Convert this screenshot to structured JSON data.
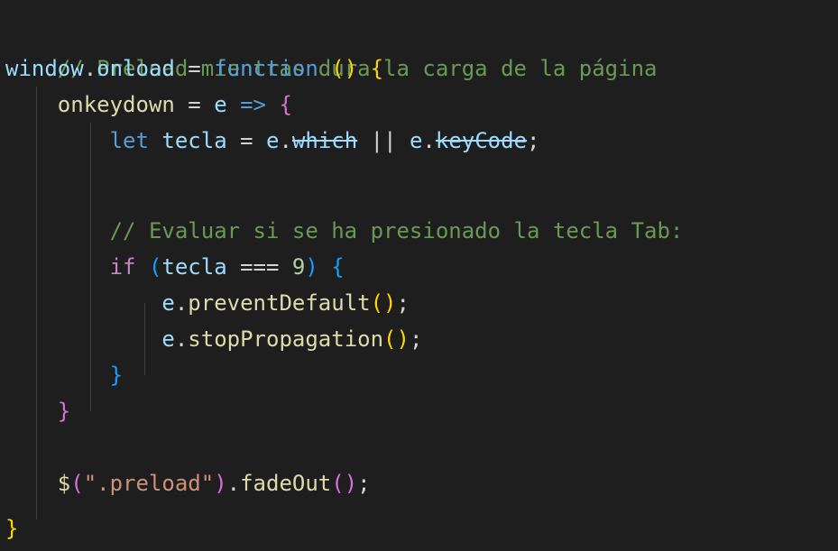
{
  "code": {
    "l1": {
      "comment": "// Preload mientras dura la carga de la página"
    },
    "l2": {
      "obj": "window",
      "dot": ".",
      "prop": "onload",
      "eq": " = ",
      "kw": "function",
      "sp": " ",
      "po": "(",
      "pc": ")",
      "sp2": " ",
      "brace": "{"
    },
    "l3": {
      "indent": "    ",
      "name": "onkeydown",
      "eq": " = ",
      "param": "e",
      "arrow": " => ",
      "brace": "{"
    },
    "l4": {
      "indent": "        ",
      "kw": "let",
      "sp": " ",
      "name": "tecla",
      "eq": " = ",
      "e1": "e",
      "dot1": ".",
      "which": "which",
      "or": " || ",
      "e2": "e",
      "dot2": ".",
      "keycode": "keyCode",
      "semi": ";"
    },
    "l6": {
      "indent": "        ",
      "comment": "// Evaluar si se ha presionado la tecla Tab:"
    },
    "l7": {
      "indent": "        ",
      "kw": "if",
      "sp": " ",
      "po": "(",
      "name": "tecla",
      "op": " === ",
      "num": "9",
      "pc": ")",
      "sp2": " ",
      "brace": "{"
    },
    "l8": {
      "indent": "            ",
      "obj": "e",
      "dot": ".",
      "fn": "preventDefault",
      "parens": "()",
      "semi": ";"
    },
    "l9": {
      "indent": "            ",
      "obj": "e",
      "dot": ".",
      "fn": "stopPropagation",
      "parens": "()",
      "semi": ";"
    },
    "l10": {
      "indent": "        ",
      "brace": "}"
    },
    "l11": {
      "indent": "    ",
      "brace": "}"
    },
    "l13": {
      "indent": "    ",
      "dollar": "$",
      "po": "(",
      "str": "\".preload\"",
      "pc": ")",
      "dot": ".",
      "fn": "fadeOut",
      "parens": "()",
      "semi": ";"
    },
    "l14": {
      "brace": "}"
    }
  },
  "colors": {
    "background": "#1e1e1e",
    "comment": "#6a9955",
    "keyword": "#569cd6",
    "function": "#dcdcaa",
    "variable": "#9cdcfe",
    "string": "#ce9178",
    "number": "#b5cea8"
  }
}
